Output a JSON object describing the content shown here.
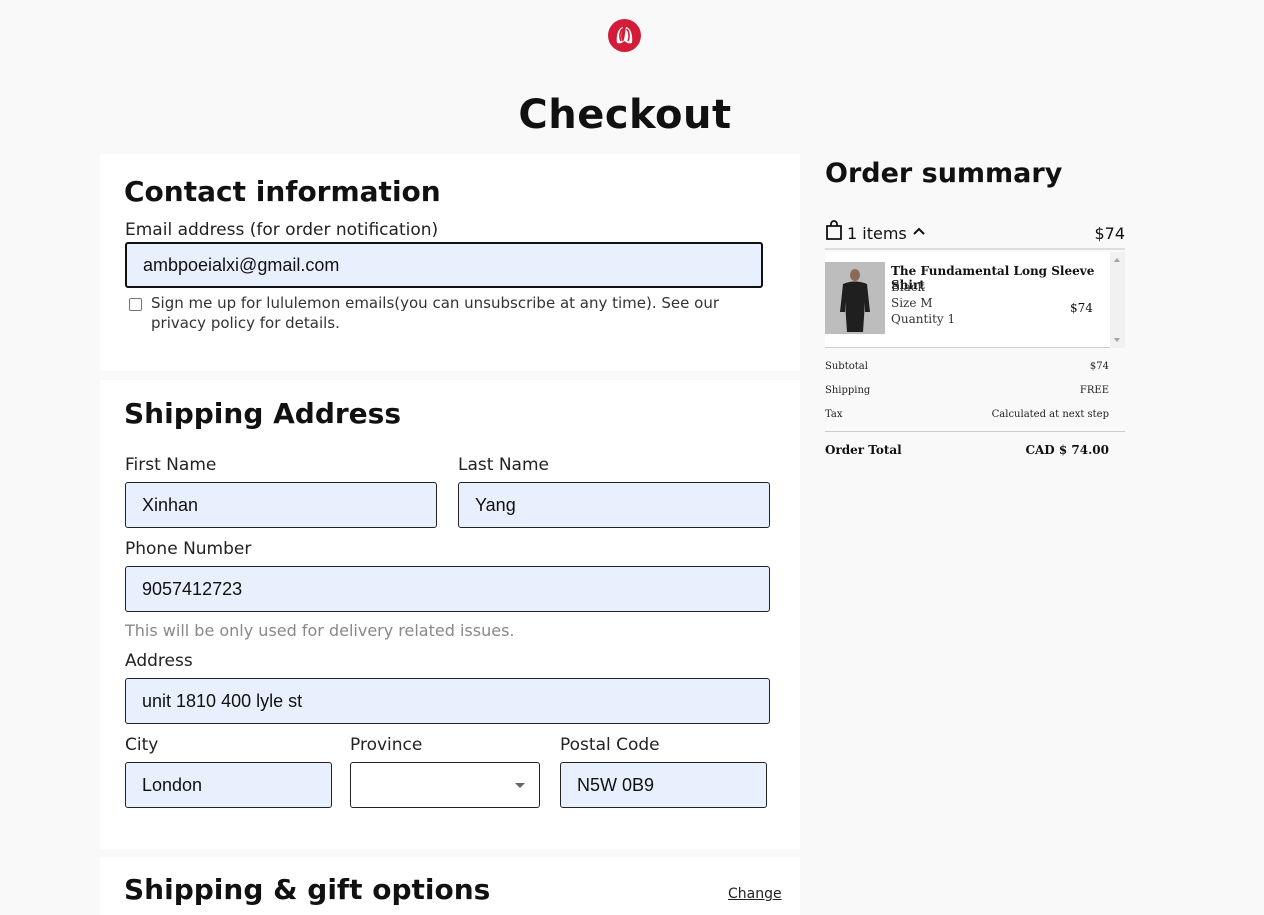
{
  "header": {
    "title": "Checkout",
    "logo_icon": "lululemon-logo-icon",
    "brand_color": "#d31c38"
  },
  "contact": {
    "heading": "Contact information",
    "email_label": "Email address (for order notification)",
    "email_value": "ambpoeialxi@gmail.com",
    "newsletter_checked": false,
    "newsletter_text": "Sign me up for lululemon emails(you can unsubscribe at any time). See our privacy policy for details."
  },
  "shipping": {
    "heading": "Shipping Address",
    "first_name_label": "First Name",
    "first_name_value": "Xinhan",
    "last_name_label": "Last Name",
    "last_name_value": "Yang",
    "phone_label": "Phone Number",
    "phone_value": "9057412723",
    "phone_hint": "This will be only used for delivery related issues.",
    "address_label": "Address",
    "address_value": "unit 1810 400 lyle st",
    "city_label": "City",
    "city_value": "London",
    "province_label": "Province",
    "province_value": "",
    "postal_label": "Postal Code",
    "postal_value": "N5W 0B9"
  },
  "gift": {
    "heading": "Shipping & gift options",
    "change_label": "Change"
  },
  "summary": {
    "heading": "Order summary",
    "items_count": "1 items",
    "items_price": "$74",
    "item": {
      "name": "The Fundamental Long Sleeve Shirt",
      "color": "Black",
      "size": "Size M",
      "quantity": "Quantity 1",
      "price": "$74"
    },
    "subtotal_label": "Subtotal",
    "subtotal_value": "$74",
    "shipping_label": "Shipping",
    "shipping_value": "FREE",
    "tax_label": "Tax",
    "tax_value": "Calculated at next step",
    "total_label": "Order Total",
    "total_value": "CAD $ 74.00"
  }
}
